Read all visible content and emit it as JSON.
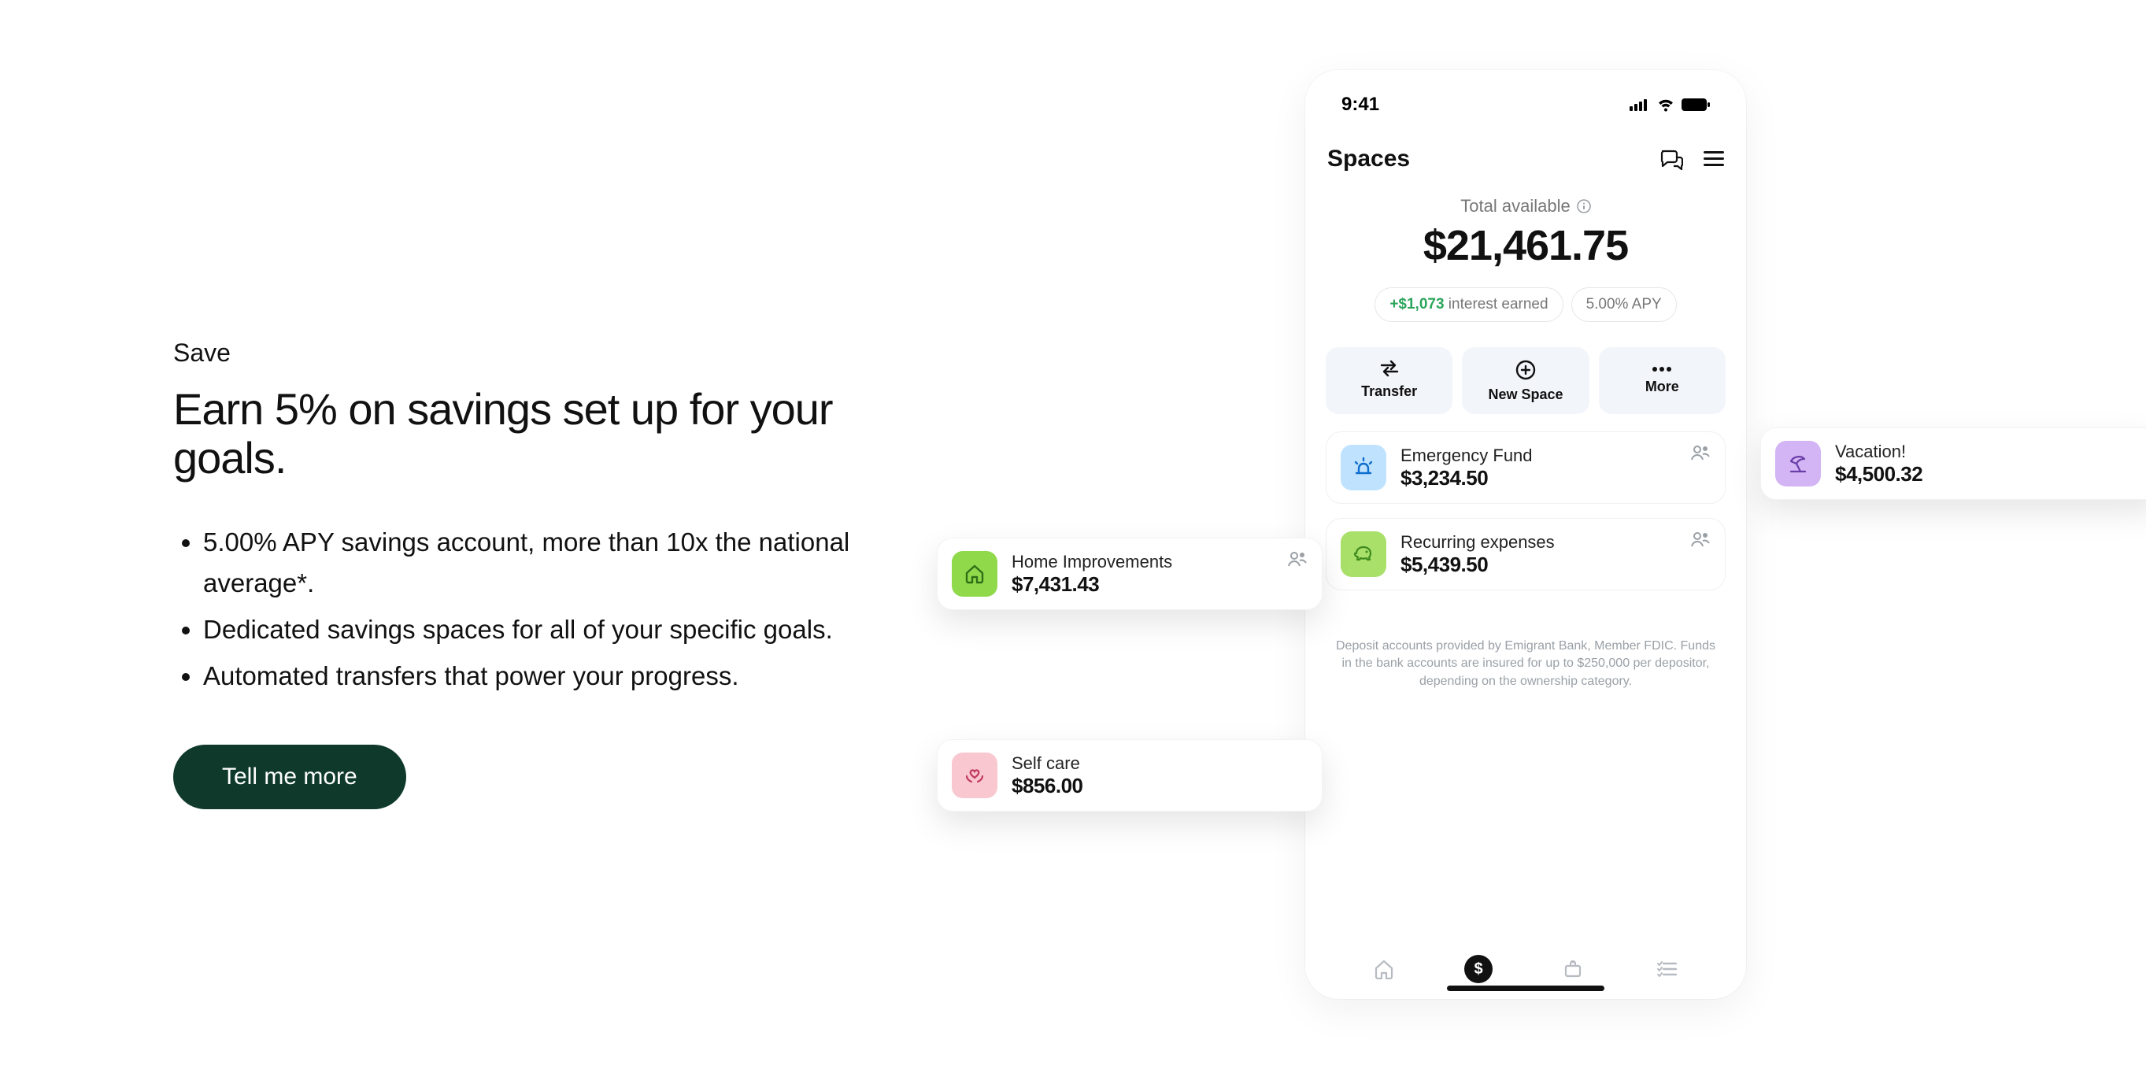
{
  "left": {
    "eyebrow": "Save",
    "headline": "Earn 5% on savings set up for your goals.",
    "bullets": [
      "5.00% APY savings account, more than 10x the national average*.",
      "Dedicated savings spaces for all of your specific goals.",
      "Automated transfers that power your progress."
    ],
    "cta": "Tell me more"
  },
  "phone": {
    "status_time": "9:41",
    "app_title": "Spaces",
    "total_label": "Total available",
    "total_amount": "$21,461.75",
    "interest_earned_amount": "+$1,073",
    "interest_earned_suffix": " interest earned",
    "apy_pill": "5.00% APY",
    "actions": {
      "transfer": "Transfer",
      "new_space": "New Space",
      "more": "More"
    },
    "spaces": {
      "emergency": {
        "name": "Emergency Fund",
        "amount": "$3,234.50"
      },
      "recurring": {
        "name": "Recurring expenses",
        "amount": "$5,439.50"
      },
      "home": {
        "name": "Home Improvements",
        "amount": "$7,431.43"
      },
      "selfcare": {
        "name": "Self care",
        "amount": "$856.00"
      },
      "vacation": {
        "name": "Vacation!",
        "amount": "$4,500.32"
      }
    },
    "disclosure": "Deposit accounts provided by Emigrant Bank, Member FDIC. Funds in the bank accounts are insured for up to $250,000 per depositor, depending on the ownership category."
  }
}
